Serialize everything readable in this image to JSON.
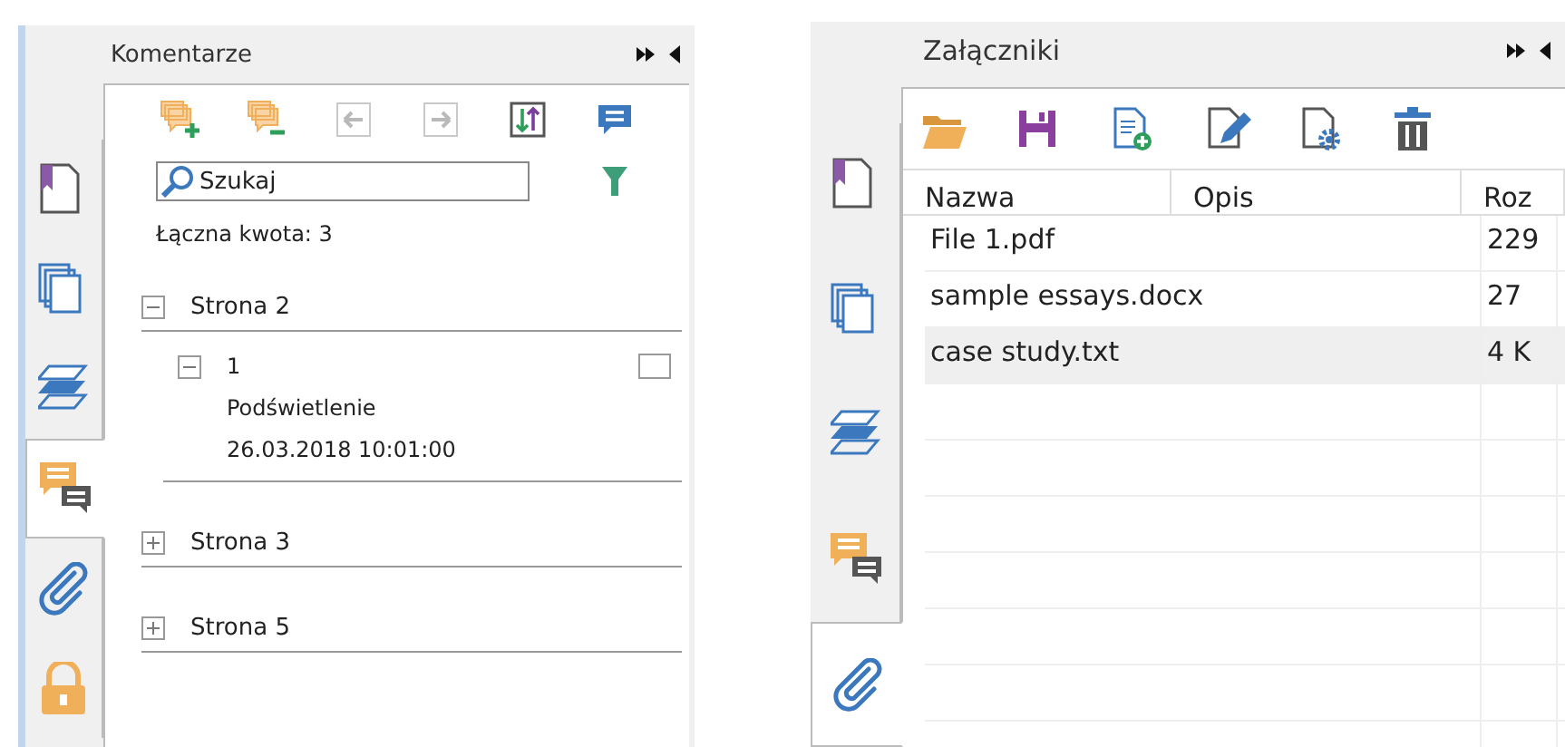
{
  "comments_panel": {
    "title": "Komentarze",
    "tabs": [
      {
        "kind": "bookmark",
        "selected": false
      },
      {
        "kind": "pages",
        "selected": false
      },
      {
        "kind": "layers",
        "selected": false
      },
      {
        "kind": "comments",
        "selected": true
      },
      {
        "kind": "attachments",
        "selected": false
      },
      {
        "kind": "lock",
        "selected": false
      }
    ],
    "toolbar": [
      {
        "kind": "add",
        "disabled": false
      },
      {
        "kind": "remove",
        "disabled": false
      },
      {
        "kind": "prev",
        "disabled": true
      },
      {
        "kind": "next",
        "disabled": true
      },
      {
        "kind": "sort",
        "disabled": false
      },
      {
        "kind": "comment",
        "disabled": false
      }
    ],
    "search": {
      "placeholder": "Szukaj"
    },
    "total": "Łączna kwota: 3",
    "pages": [
      {
        "label": "Strona 2",
        "expanded": true,
        "children": [
          {
            "label": "1",
            "type": "Podświetlenie",
            "date": "26.03.2018 10:01:00",
            "expanded": true,
            "checked": false
          }
        ]
      },
      {
        "label": "Strona 3",
        "expanded": false
      },
      {
        "label": "Strona 5",
        "expanded": false
      }
    ]
  },
  "attachments_panel": {
    "title": "Załączniki",
    "tabs": [
      {
        "kind": "bookmark",
        "selected": false
      },
      {
        "kind": "pages",
        "selected": false
      },
      {
        "kind": "layers",
        "selected": false
      },
      {
        "kind": "comments",
        "selected": false
      },
      {
        "kind": "attachments",
        "selected": true
      }
    ],
    "toolbar": [
      {
        "kind": "open"
      },
      {
        "kind": "save"
      },
      {
        "kind": "add-file"
      },
      {
        "kind": "edit-file"
      },
      {
        "kind": "file-settings"
      },
      {
        "kind": "delete"
      }
    ],
    "table": {
      "columns": [
        {
          "label": "Nazwa"
        },
        {
          "label": "Opis"
        },
        {
          "label": "Roz"
        }
      ],
      "rows": [
        {
          "name": "File 1.pdf",
          "size": "229",
          "selected": false
        },
        {
          "name": "sample essays.docx",
          "size": "27",
          "selected": false
        },
        {
          "name": "case study.txt",
          "size": "4 K",
          "selected": true
        }
      ]
    }
  }
}
